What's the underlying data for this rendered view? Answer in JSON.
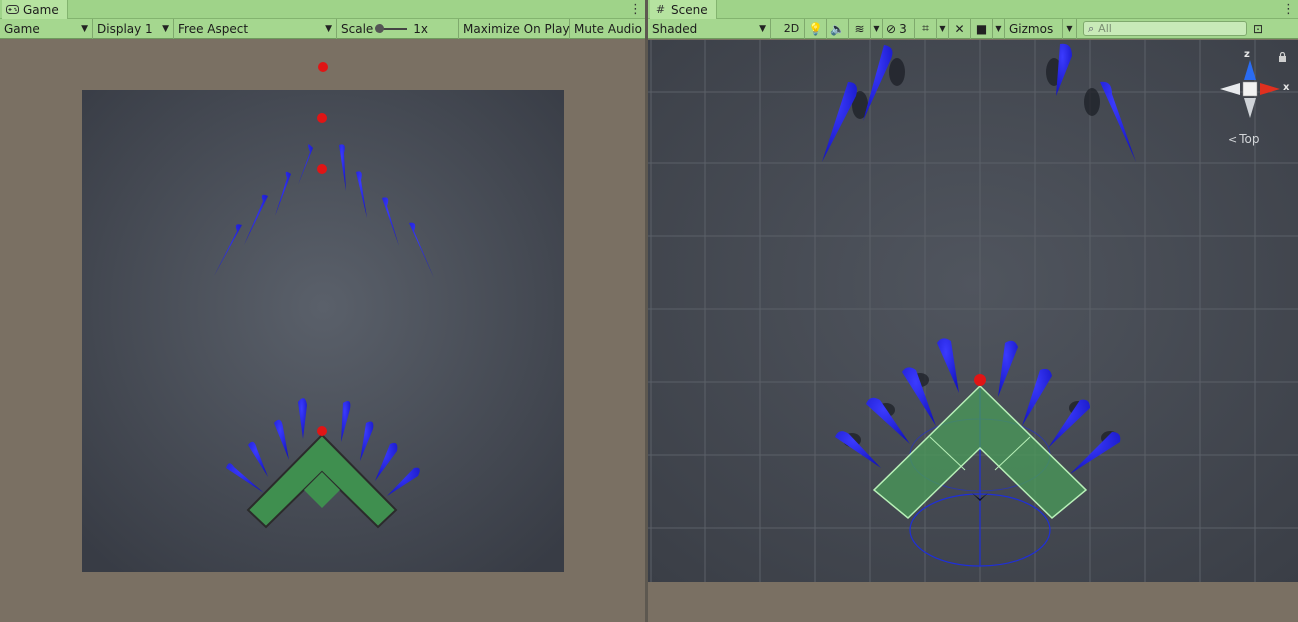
{
  "game": {
    "tab_label": "Game",
    "toolbar": {
      "view_select": "Game",
      "display_select": "Display 1",
      "aspect_select": "Free Aspect",
      "scale_label": "Scale",
      "scale_value": "1x",
      "maximize_label": "Maximize On Play",
      "mute_label": "Mute Audio"
    }
  },
  "scene": {
    "tab_label": "Scene",
    "toolbar": {
      "shading_select": "Shaded",
      "mode_2d_label": "2D",
      "hidden_count": "3",
      "gizmos_label": "Gizmos",
      "search_placeholder": "All"
    },
    "gizmo": {
      "axis_z": "z",
      "axis_x": "x",
      "view_label": "Top"
    }
  },
  "colors": {
    "accent_tab": "#9fd389",
    "player_green": "#3f8f4f",
    "enemy_blue": "#2424e6",
    "bullet_red": "#e01515",
    "axis_x_red": "#e0301f",
    "axis_z_blue": "#2a6cf2"
  }
}
